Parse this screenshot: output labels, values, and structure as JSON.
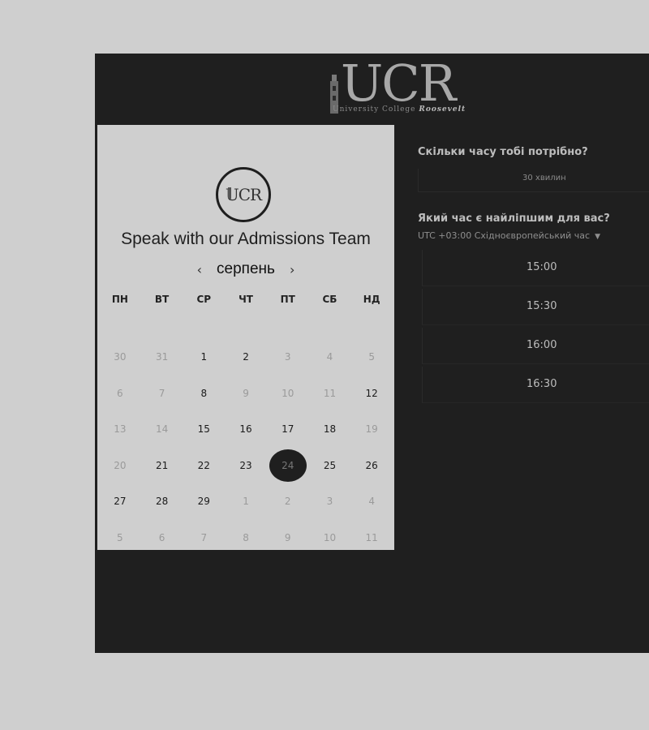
{
  "brand": {
    "wordmark": "UCR",
    "tagline_prefix": "University College",
    "tagline_suffix": "Roosevelt"
  },
  "card": {
    "seal_text": "UCR",
    "title": "Speak with our Admissions Team",
    "month": "серпень",
    "prev_arrow": "‹",
    "next_arrow": "›",
    "weekdays": [
      "ПН",
      "ВТ",
      "СР",
      "ЧТ",
      "ПТ",
      "СБ",
      "НД"
    ],
    "weeks": [
      [
        {
          "t": "30",
          "s": "off"
        },
        {
          "t": "31",
          "s": "off"
        },
        {
          "t": "1",
          "s": "avail"
        },
        {
          "t": "2",
          "s": "avail"
        },
        {
          "t": "3",
          "s": "off"
        },
        {
          "t": "4",
          "s": "off"
        },
        {
          "t": "5",
          "s": "off"
        }
      ],
      [
        {
          "t": "6",
          "s": "off"
        },
        {
          "t": "7",
          "s": "off"
        },
        {
          "t": "8",
          "s": "avail"
        },
        {
          "t": "9",
          "s": "off"
        },
        {
          "t": "10",
          "s": "off"
        },
        {
          "t": "11",
          "s": "off"
        },
        {
          "t": "12",
          "s": "avail"
        }
      ],
      [
        {
          "t": "13",
          "s": "off"
        },
        {
          "t": "14",
          "s": "off"
        },
        {
          "t": "15",
          "s": "avail"
        },
        {
          "t": "16",
          "s": "avail"
        },
        {
          "t": "17",
          "s": "avail"
        },
        {
          "t": "18",
          "s": "avail"
        },
        {
          "t": "19",
          "s": "off"
        }
      ],
      [
        {
          "t": "20",
          "s": "off"
        },
        {
          "t": "21",
          "s": "avail"
        },
        {
          "t": "22",
          "s": "avail"
        },
        {
          "t": "23",
          "s": "avail"
        },
        {
          "t": "24",
          "s": "sel"
        },
        {
          "t": "25",
          "s": "avail"
        },
        {
          "t": "26",
          "s": "avail"
        }
      ],
      [
        {
          "t": "27",
          "s": "avail"
        },
        {
          "t": "28",
          "s": "avail"
        },
        {
          "t": "29",
          "s": "avail"
        },
        {
          "t": "1",
          "s": "off"
        },
        {
          "t": "2",
          "s": "off"
        },
        {
          "t": "3",
          "s": "off"
        },
        {
          "t": "4",
          "s": "off"
        }
      ],
      [
        {
          "t": "5",
          "s": "off"
        },
        {
          "t": "6",
          "s": "off"
        },
        {
          "t": "7",
          "s": "off"
        },
        {
          "t": "8",
          "s": "off"
        },
        {
          "t": "9",
          "s": "off"
        },
        {
          "t": "10",
          "s": "off"
        },
        {
          "t": "11",
          "s": "off"
        }
      ]
    ]
  },
  "booking": {
    "duration_question": "Скільки часу тобі потрібно?",
    "duration_value": "30 хвилин",
    "time_question": "Який час є найліпшим для вас?",
    "timezone": "UTC +03:00 Східноєвропейський час",
    "timezone_chevron": "▼",
    "slots": [
      "15:00",
      "15:30",
      "16:00",
      "16:30"
    ]
  }
}
